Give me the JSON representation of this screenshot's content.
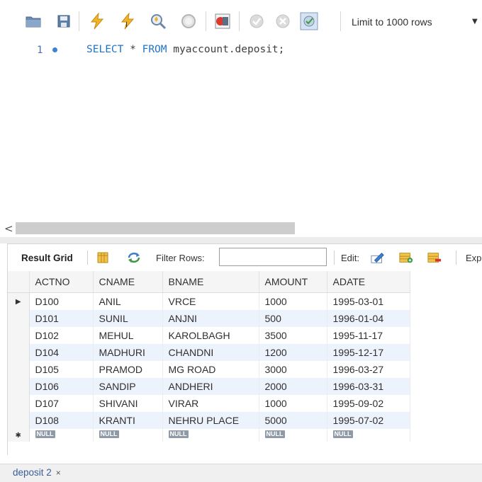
{
  "toolbar": {
    "buttons": [
      {
        "name": "open-folder-icon"
      },
      {
        "name": "save-icon"
      },
      {
        "name": "execute-icon"
      },
      {
        "name": "execute-current-icon"
      },
      {
        "name": "explain-icon"
      },
      {
        "name": "stop-icon"
      },
      {
        "name": "toggle-error-icon"
      },
      {
        "name": "commit-icon"
      },
      {
        "name": "rollback-icon"
      },
      {
        "name": "autocommit-icon"
      }
    ],
    "limit_label": "Limit to 1000 rows"
  },
  "editor": {
    "line_number": "1",
    "sql_keyword_1": "SELECT",
    "sql_star": " * ",
    "sql_keyword_2": "FROM",
    "sql_rest": " myaccount.deposit;"
  },
  "result_toolbar": {
    "result_grid_label": "Result Grid",
    "filter_label": "Filter Rows:",
    "filter_value": "",
    "edit_label": "Edit:",
    "export_label": "Exp"
  },
  "grid": {
    "columns": [
      "ACTNO",
      "CNAME",
      "BNAME",
      "AMOUNT",
      "ADATE"
    ],
    "rows": [
      [
        "D100",
        "ANIL",
        "VRCE",
        "1000",
        "1995-03-01"
      ],
      [
        "D101",
        "SUNIL",
        "ANJNI",
        "500",
        "1996-01-04"
      ],
      [
        "D102",
        "MEHUL",
        "KAROLBAGH",
        "3500",
        "1995-11-17"
      ],
      [
        "D104",
        "MADHURI",
        "CHANDNI",
        "1200",
        "1995-12-17"
      ],
      [
        "D105",
        "PRAMOD",
        "MG ROAD",
        "3000",
        "1996-03-27"
      ],
      [
        "D106",
        "SANDIP",
        "ANDHERI",
        "2000",
        "1996-03-31"
      ],
      [
        "D107",
        "SHIVANI",
        "VIRAR",
        "1000",
        "1995-09-02"
      ],
      [
        "D108",
        "KRANTI",
        "NEHRU PLACE",
        "5000",
        "1995-07-02"
      ]
    ],
    "null_label": "NULL",
    "current_row_marker": "▶",
    "new_row_marker": "✱"
  },
  "tabs": {
    "active_tab": "deposit 2",
    "close_glyph": "×"
  },
  "colors": {
    "keyword": "#1d74c8",
    "alt_row": "#edf3fc",
    "null_badge": "#8f9aa6"
  }
}
